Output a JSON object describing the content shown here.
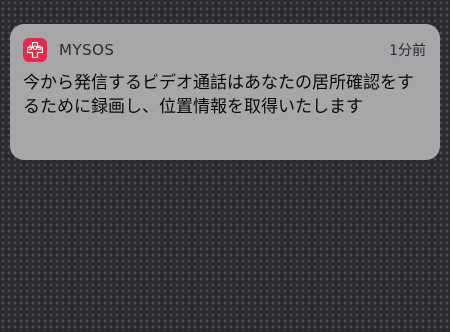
{
  "notification": {
    "app_name": "MYSOS",
    "app_icon": {
      "name": "mysos-app-icon",
      "label": "SOS",
      "color": "#e8294a"
    },
    "time": "1分前",
    "message": "今から発信するビデオ通話はあなたの居所確認をするために録画し、位置情報を取得いたします"
  }
}
